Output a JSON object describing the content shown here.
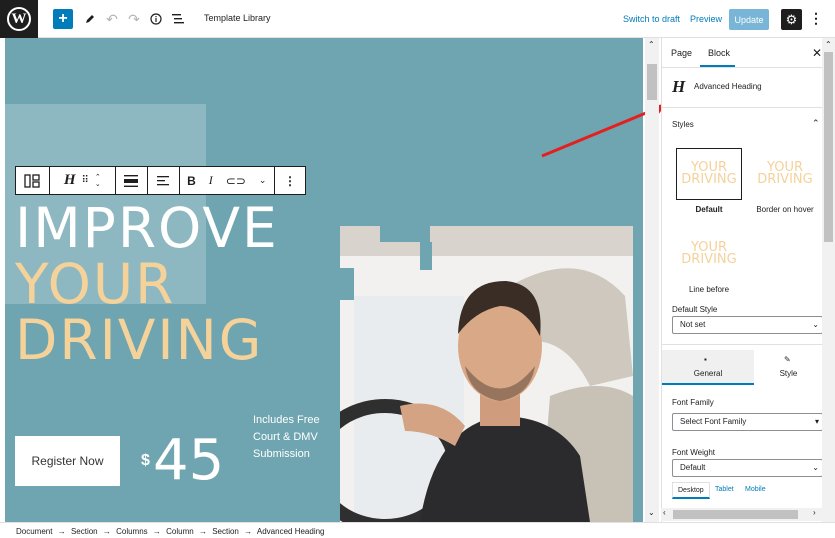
{
  "topbar": {
    "document_title": "Template Library",
    "switch_to_draft": "Switch to draft",
    "preview": "Preview",
    "update": "Update",
    "add_icon": "plus-icon",
    "colors": {
      "accent": "#007cba",
      "dark": "#1e1e1e"
    }
  },
  "canvas": {
    "heading_line1": "IMPROVE",
    "heading_line2": "YOUR",
    "heading_line3": "DRIVING",
    "register_button": "Register Now",
    "price_symbol": "$",
    "price_value": "45",
    "includes_text": "Includes Free Court & DMV Submission",
    "colors": {
      "background": "#6fa5b0",
      "heading_accent": "#f4d29a"
    }
  },
  "sidebar": {
    "tabs": [
      {
        "label": "Page",
        "active": false
      },
      {
        "label": "Block",
        "active": true
      }
    ],
    "block_name": "Advanced Heading",
    "styles_title": "Styles",
    "style_preview_text": "YOUR DRIVING",
    "styles": [
      {
        "label": "Default",
        "selected": true
      },
      {
        "label": "Border on hover",
        "selected": false
      },
      {
        "label": "Line before",
        "selected": false
      }
    ],
    "default_style_label": "Default Style",
    "default_style_value": "Not set",
    "general_tab": "General",
    "style_tab": "Style",
    "font_family_label": "Font Family",
    "font_family_value": "Select Font Family",
    "font_weight_label": "Font Weight",
    "font_weight_value": "Default",
    "device_tabs": [
      "Desktop",
      "Tablet",
      "Mobile"
    ]
  },
  "footer": {
    "breadcrumb": [
      "Document",
      "Section",
      "Columns",
      "Column",
      "Section",
      "Advanced Heading"
    ],
    "separator": "→"
  }
}
